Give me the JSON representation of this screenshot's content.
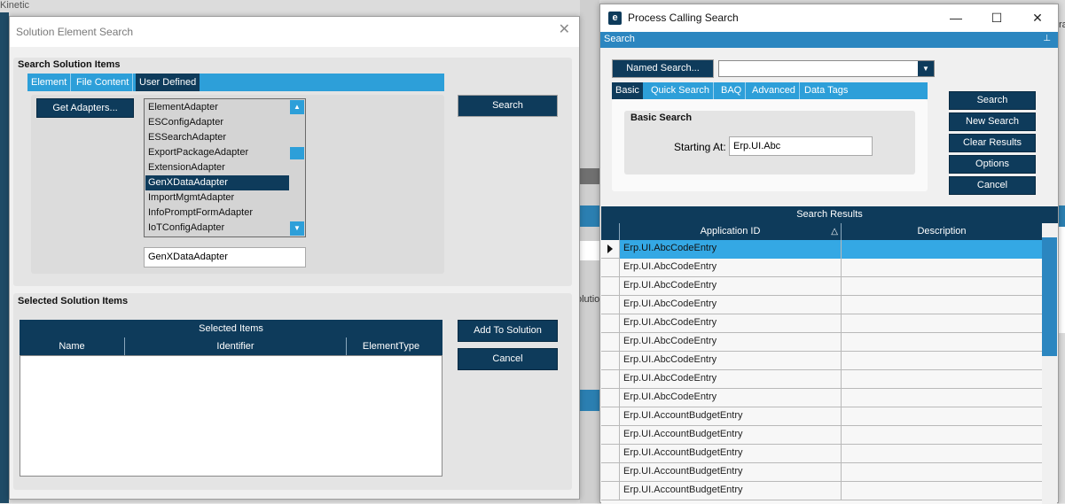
{
  "background_app": {
    "title": "Kinetic",
    "partial_label": "olutio",
    "partial_right": "ra"
  },
  "solution_search": {
    "title": "Solution Element Search",
    "close_glyph": "✕",
    "search_items_header": "Search Solution Items",
    "tabs": [
      "Element",
      "File Content",
      "User Defined"
    ],
    "active_tab": "User Defined",
    "get_adapters_label": "Get Adapters...",
    "search_button": "Search",
    "adapters": [
      "ElementAdapter",
      "ESConfigAdapter",
      "ESSearchAdapter",
      "ExportPackageAdapter",
      "ExtensionAdapter",
      "GenXDataAdapter",
      "ImportMgmtAdapter",
      "InfoPromptFormAdapter",
      "IoTConfigAdapter"
    ],
    "selected_adapter": "GenXDataAdapter",
    "adapter_value": "GenXDataAdapter",
    "selected_items_header": "Selected Solution Items",
    "grid_title": "Selected Items",
    "grid_columns": [
      "Name",
      "Identifier",
      "ElementType"
    ],
    "add_to_solution": "Add To Solution",
    "cancel": "Cancel"
  },
  "process_search": {
    "title": "Process Calling Search",
    "logo_letter": "e",
    "search_bar_label": "Search",
    "pin_glyph": "⊥",
    "named_search_label": "Named Search...",
    "named_search_value": "",
    "tabs": [
      "Basic",
      "Quick Search",
      "BAQ",
      "Advanced",
      "Data Tags"
    ],
    "active_tab": "Basic",
    "basic_search_header": "Basic Search",
    "starting_at_label": "Starting At:",
    "starting_at_value": "Erp.UI.Abc",
    "buttons": [
      "Search",
      "New Search",
      "Clear Results",
      "Options",
      "Cancel"
    ],
    "results_title": "Search Results",
    "columns": [
      "Application ID",
      "Description"
    ],
    "sort_glyph": "△",
    "rows": [
      {
        "app_id": "Erp.UI.AbcCodeEntry",
        "description": ""
      },
      {
        "app_id": "Erp.UI.AbcCodeEntry",
        "description": ""
      },
      {
        "app_id": "Erp.UI.AbcCodeEntry",
        "description": ""
      },
      {
        "app_id": "Erp.UI.AbcCodeEntry",
        "description": ""
      },
      {
        "app_id": "Erp.UI.AbcCodeEntry",
        "description": ""
      },
      {
        "app_id": "Erp.UI.AbcCodeEntry",
        "description": ""
      },
      {
        "app_id": "Erp.UI.AbcCodeEntry",
        "description": ""
      },
      {
        "app_id": "Erp.UI.AbcCodeEntry",
        "description": ""
      },
      {
        "app_id": "Erp.UI.AbcCodeEntry",
        "description": ""
      },
      {
        "app_id": "Erp.UI.AccountBudgetEntry",
        "description": ""
      },
      {
        "app_id": "Erp.UI.AccountBudgetEntry",
        "description": ""
      },
      {
        "app_id": "Erp.UI.AccountBudgetEntry",
        "description": ""
      },
      {
        "app_id": "Erp.UI.AccountBudgetEntry",
        "description": ""
      },
      {
        "app_id": "Erp.UI.AccountBudgetEntry",
        "description": ""
      }
    ],
    "selected_row": 0
  },
  "colors": {
    "accent_dark": "#0e3b5b",
    "accent_light": "#2d9fd9",
    "selection": "#34a8e4"
  },
  "icons": [
    "close-icon",
    "minimize-icon",
    "maximize-icon",
    "pin-icon",
    "dropdown-arrow-icon",
    "scroll-up-icon",
    "scroll-down-icon",
    "sort-asc-icon",
    "row-indicator-icon",
    "epicor-logo-icon"
  ]
}
